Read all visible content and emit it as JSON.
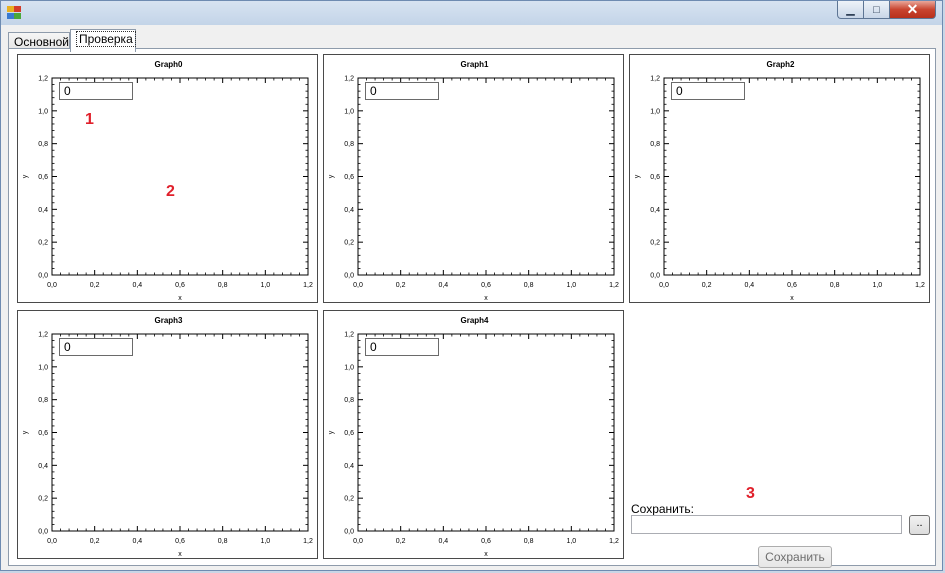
{
  "window": {
    "controls": {
      "minimize": "▁",
      "maximize": "□",
      "close": "✕"
    }
  },
  "tabs": [
    {
      "label": "Основной"
    },
    {
      "label": "Проверка"
    }
  ],
  "graphs": [
    {
      "title": "Graph0",
      "value": "0"
    },
    {
      "title": "Graph1",
      "value": "0"
    },
    {
      "title": "Graph2",
      "value": "0"
    },
    {
      "title": "Graph3",
      "value": "0"
    },
    {
      "title": "Graph4",
      "value": "0"
    }
  ],
  "axis": {
    "xlabel": "x",
    "ylabel": "y",
    "ticks": [
      "0,0",
      "0,2",
      "0,4",
      "0,6",
      "0,8",
      "1,0",
      "1,2"
    ]
  },
  "save": {
    "label": "Сохранить:",
    "path_value": "",
    "browse_label": "..",
    "button_label": "Сохранить"
  },
  "markers": {
    "m1": "1",
    "m2": "2",
    "m3": "3"
  },
  "colors": {
    "marker": "#e0202b",
    "close_button": "#c9442f"
  }
}
